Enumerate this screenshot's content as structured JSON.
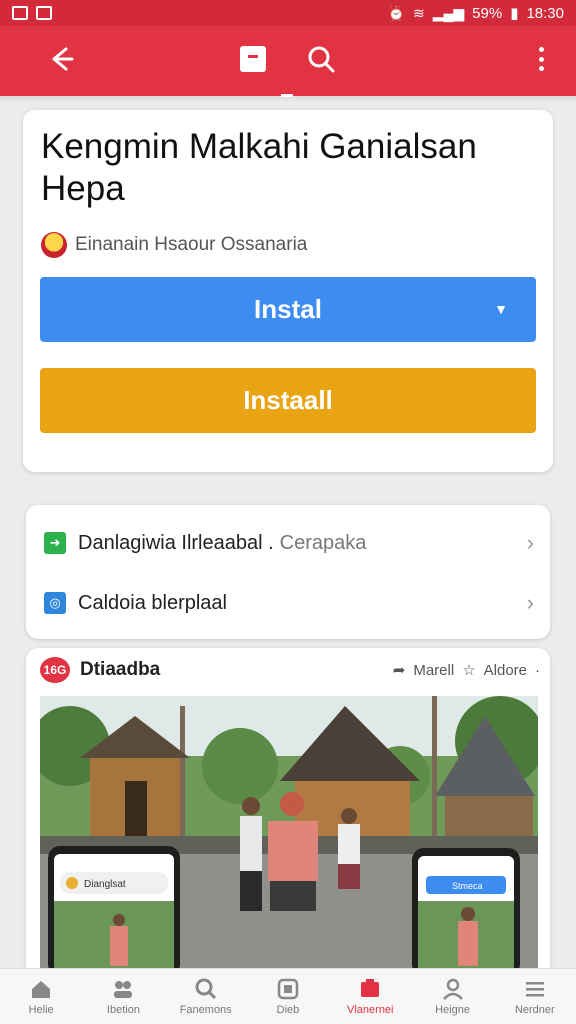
{
  "status_bar": {
    "battery": "59%",
    "time": "18:30"
  },
  "app_bar": {
    "back_icon": "arrow-back-icon",
    "bookmark_icon": "bookmark-icon",
    "search_icon": "search-icon",
    "menu_icon": "more-vert-icon"
  },
  "app": {
    "title": "Kengmin Malkahi Ganialsan Hepa",
    "developer": "Einanain Hsaour Ossanaria",
    "install_primary_label": "Instal",
    "install_secondary_label": "Instaall"
  },
  "links": [
    {
      "label": "Danlagiwia Ilrleaabal .",
      "suffix": "Cerapaka",
      "icon": "download-icon",
      "color": "#2bb24c"
    },
    {
      "label": "Caldoia blerplaal",
      "suffix": "",
      "icon": "calendar-icon",
      "color": "#2f86dd"
    }
  ],
  "feed_card": {
    "logo_text": "16G",
    "title": "Dtiaadba",
    "share_label": "Marell",
    "save_label": "Aldore",
    "phone_left_text": "Dianglsat",
    "phone_right_text": "Stmeca"
  },
  "bottom_nav": [
    {
      "label": "Helie",
      "icon": "home-icon",
      "active": false
    },
    {
      "label": "Ibetion",
      "icon": "people-icon",
      "active": false
    },
    {
      "label": "Fanemons",
      "icon": "search-icon",
      "active": false
    },
    {
      "label": "Dieb",
      "icon": "apps-icon",
      "active": false
    },
    {
      "label": "Vlanernei",
      "icon": "store-icon",
      "active": true
    },
    {
      "label": "Heigne",
      "icon": "person-icon",
      "active": false
    },
    {
      "label": "Nerdner",
      "icon": "menu-icon",
      "active": false
    }
  ],
  "colors": {
    "primary_red": "#e23343",
    "install_blue": "#3d8df0",
    "install_orange": "#e8a413"
  }
}
